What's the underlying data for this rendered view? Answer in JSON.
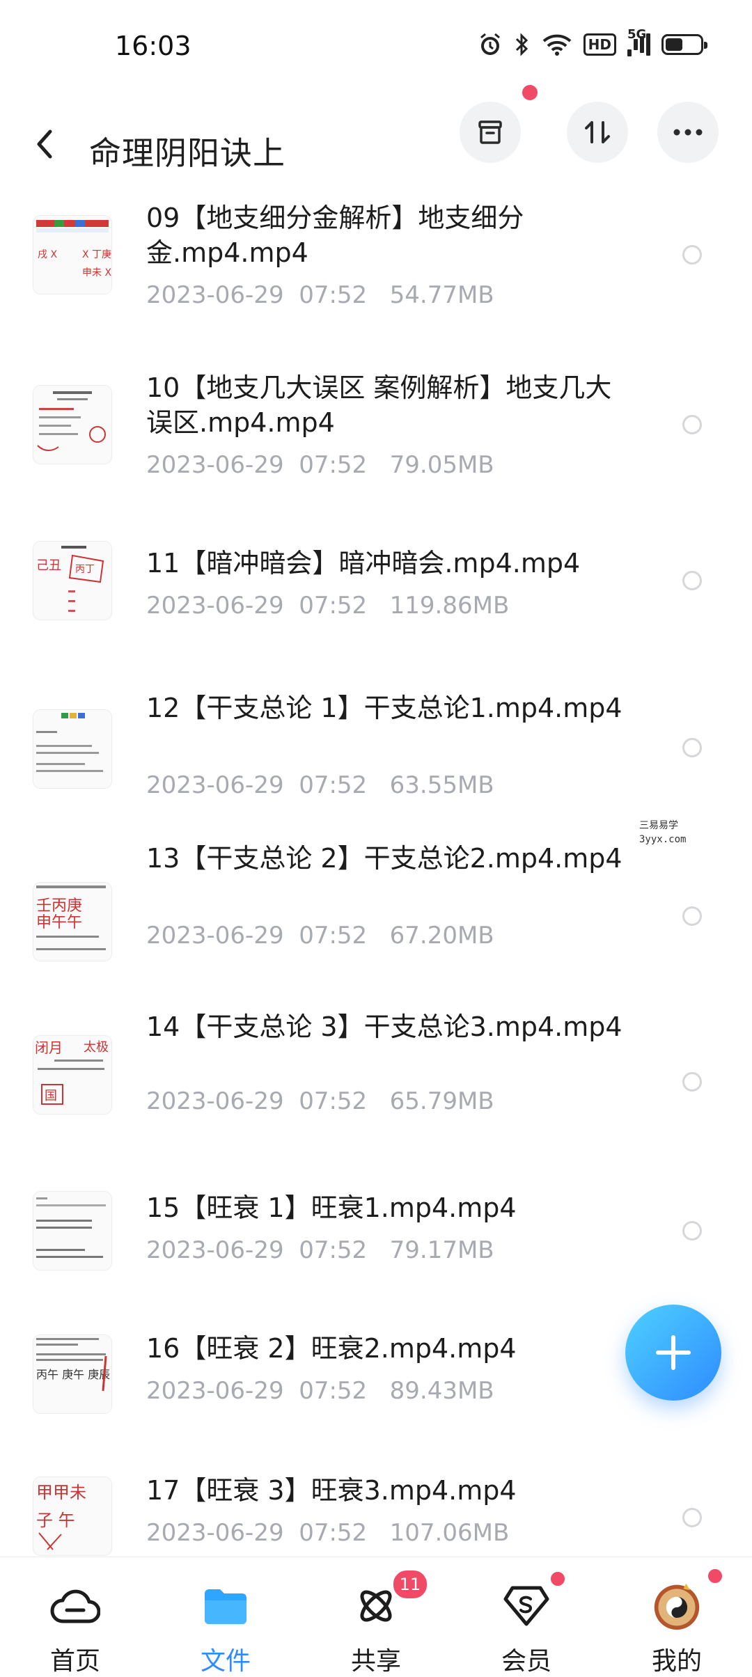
{
  "status_bar": {
    "time": "16:03",
    "hd": "HD",
    "network": "5G"
  },
  "header": {
    "title": "命理阴阳诀上"
  },
  "files": [
    {
      "name": "09【地支细分金解析】地支细分金.mp4.mp4",
      "date": "2023-06-29  07:52",
      "size": "54.77MB"
    },
    {
      "name": "10【地支几大误区 案例解析】地支几大误区.mp4.mp4",
      "date": "2023-06-29  07:52",
      "size": "79.05MB"
    },
    {
      "name": "11【暗冲暗会】暗冲暗会.mp4.mp4",
      "date": "2023-06-29  07:52",
      "size": "119.86MB"
    },
    {
      "name": "12【干支总论 1】干支总论1.mp4.mp4",
      "date": "2023-06-29  07:52",
      "size": "63.55MB"
    },
    {
      "name": "13【干支总论 2】干支总论2.mp4.mp4",
      "date": "2023-06-29  07:52",
      "size": "67.20MB"
    },
    {
      "name": "14【干支总论 3】干支总论3.mp4.mp4",
      "date": "2023-06-29  07:52",
      "size": "65.79MB"
    },
    {
      "name": "15【旺衰 1】旺衰1.mp4.mp4",
      "date": "2023-06-29  07:52",
      "size": "79.17MB"
    },
    {
      "name": "16【旺衰 2】旺衰2.mp4.mp4",
      "date": "2023-06-29  07:52",
      "size": "89.43MB"
    },
    {
      "name": "17【旺衰 3】旺衰3.mp4.mp4",
      "date": "2023-06-29  07:52",
      "size": "107.06MB"
    }
  ],
  "watermark": {
    "line1": "三易易学",
    "line2": "3yyx.com"
  },
  "nav": [
    {
      "label": "首页",
      "icon": "cloud-home-icon"
    },
    {
      "label": "文件",
      "icon": "folder-icon",
      "active": true
    },
    {
      "label": "共享",
      "icon": "share-orbit-icon",
      "badge": "11"
    },
    {
      "label": "会员",
      "icon": "vip-diamond-icon"
    },
    {
      "label": "我的",
      "icon": "avatar-icon"
    }
  ],
  "colors": {
    "accent": "#2e8cff",
    "badge": "#f04a67",
    "meta": "#a7aab0"
  }
}
